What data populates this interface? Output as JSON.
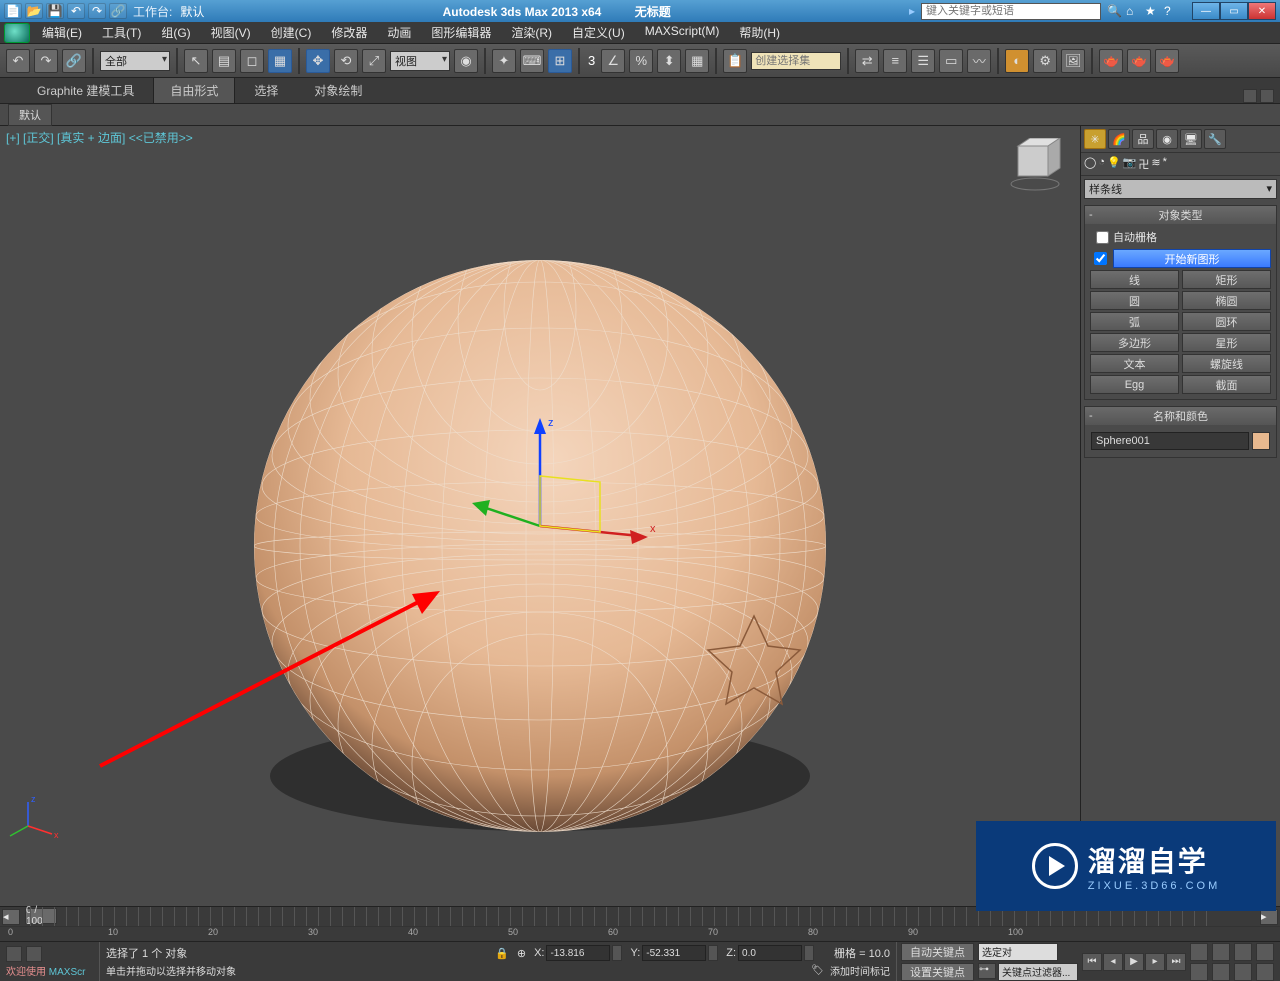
{
  "titlebar": {
    "workspace_label": "工作台:",
    "workspace_value": "默认",
    "app_title": "Autodesk 3ds Max  2013 x64",
    "doc_title": "无标题",
    "search_placeholder": "键入关键字或短语"
  },
  "menubar": {
    "items": [
      "编辑(E)",
      "工具(T)",
      "组(G)",
      "视图(V)",
      "创建(C)",
      "修改器",
      "动画",
      "图形编辑器",
      "渲染(R)",
      "自定义(U)",
      "MAXScript(M)",
      "帮助(H)"
    ]
  },
  "maintoolbar": {
    "filter": "全部",
    "view_mode": "视图",
    "num3": "3",
    "named_sel_placeholder": "创建选择集"
  },
  "ribbon": {
    "tabs": [
      "Graphite 建模工具",
      "自由形式",
      "选择",
      "对象绘制"
    ],
    "active_index": 1,
    "sublabel": "默认"
  },
  "viewport": {
    "label": "[+] [正交] [真实 + 边面]  <<已禁用>>"
  },
  "cmdpanel": {
    "category": "样条线",
    "rollout_objtype": "对象类型",
    "autogrid_label": "自动栅格",
    "start_new_shape": "开始新图形",
    "buttons": [
      [
        "线",
        "矩形"
      ],
      [
        "圆",
        "椭圆"
      ],
      [
        "弧",
        "圆环"
      ],
      [
        "多边形",
        "星形"
      ],
      [
        "文本",
        "螺旋线"
      ],
      [
        "Egg",
        "截面"
      ]
    ],
    "rollout_name": "名称和颜色",
    "object_name": "Sphere001"
  },
  "timeline": {
    "frame": "0 / 100",
    "ticks": [
      0,
      10,
      20,
      30,
      40,
      50,
      60,
      70,
      80,
      90,
      100
    ]
  },
  "status": {
    "welcome": "欢迎使用",
    "maxscr": "MAXScr",
    "selected": "选择了 1 个 对象",
    "hint": "单击并拖动以选择并移动对象",
    "x": "-13.816",
    "y": "-52.331",
    "z": "0.0",
    "grid": "栅格 = 10.0",
    "add_time_tag": "添加时间标记",
    "auto_key": "自动关键点",
    "set_key": "设置关键点",
    "selected_dropdown": "选定对",
    "key_filter": "关键点过滤器..."
  },
  "watermark": {
    "brand": "溜溜自学",
    "sub": "ZIXUE.3D66.COM"
  }
}
